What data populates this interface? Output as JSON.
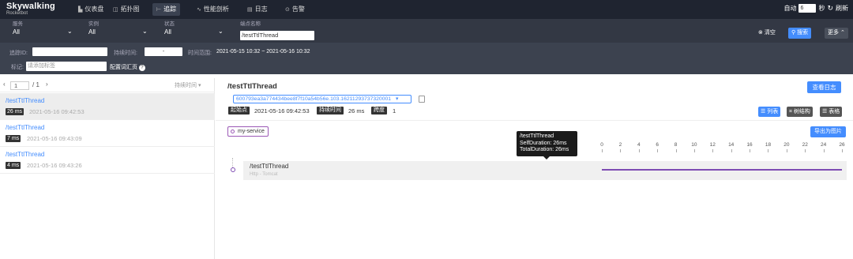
{
  "nav": {
    "logo_title": "Skywalking",
    "logo_sub": "Rocketbot",
    "items": [
      {
        "label": "仪表盘",
        "icon": "dashboard-icon",
        "glyph": "▙"
      },
      {
        "label": "拓扑图",
        "icon": "topology-icon",
        "glyph": "◫"
      },
      {
        "label": "追踪",
        "icon": "trace-icon",
        "glyph": "⊢"
      },
      {
        "label": "性能剖析",
        "icon": "profile-icon",
        "glyph": "∿"
      },
      {
        "label": "日志",
        "icon": "log-icon",
        "glyph": "▤"
      },
      {
        "label": "告警",
        "icon": "alarm-icon",
        "glyph": "⊙"
      }
    ],
    "auto_label": "自动",
    "auto_value": "6",
    "seconds_label": "秒",
    "refresh_label": "刷新"
  },
  "filters": {
    "service_label": "服务",
    "service_value": "All",
    "instance_label": "实例",
    "instance_value": "All",
    "status_label": "状态",
    "status_value": "All",
    "endpoint_label": "端点名称",
    "endpoint_value": "/testTtlThread",
    "clear_label": "清空",
    "search_label": "搜索",
    "more_label": "更多",
    "traceid_label": "追踪ID:",
    "duration_label": "持续时间:",
    "duration_sep": "-",
    "timerange_label": "时间范围:",
    "timerange_value": "2021-05-15 10:32 ~ 2021-05-16 10:32",
    "tags_label": "标记:",
    "tags_placeholder": "请添加标签",
    "config_link": "配置词汇页"
  },
  "list": {
    "page": "1",
    "page_total": "/ 1",
    "sort_label": "持续时间",
    "traces": [
      {
        "endpoint": "/testTtlThread",
        "duration": "26 ms",
        "time": "2021-05-16 09:42:53"
      },
      {
        "endpoint": "/testTtlThread",
        "duration": "7 ms",
        "time": "2021-05-16 09:43:09"
      },
      {
        "endpoint": "/testTtlThread",
        "duration": "4 ms",
        "time": "2021-05-16 09:43:26"
      }
    ]
  },
  "detail": {
    "title": "/testTtlThread",
    "view_logs": "查看日志",
    "trace_id": "600793ea3a774434bee8f7f10a54b56e.103.16211293737320001",
    "start_label": "起始点",
    "start_value": "2021-05-16 09:42:53",
    "duration_label": "持续时间",
    "duration_value": "26 ms",
    "span_label": "跨度",
    "span_value": "1",
    "view_list": "列表",
    "view_tree": "树结构",
    "view_table": "表格",
    "service_tag": "my-service",
    "export": "导出为图片",
    "tooltip_title": "/testTtlThread",
    "tooltip_self": "SelfDuration: 26ms",
    "tooltip_total": "TotalDuration: 26ms",
    "axis_ticks": [
      "0",
      "2",
      "4",
      "6",
      "8",
      "10",
      "12",
      "14",
      "16",
      "18",
      "20",
      "22",
      "24",
      "26"
    ],
    "span_name": "/testTtlThread",
    "span_sub": "Http - Tomcat",
    "span_color": "#7e4cb3"
  }
}
